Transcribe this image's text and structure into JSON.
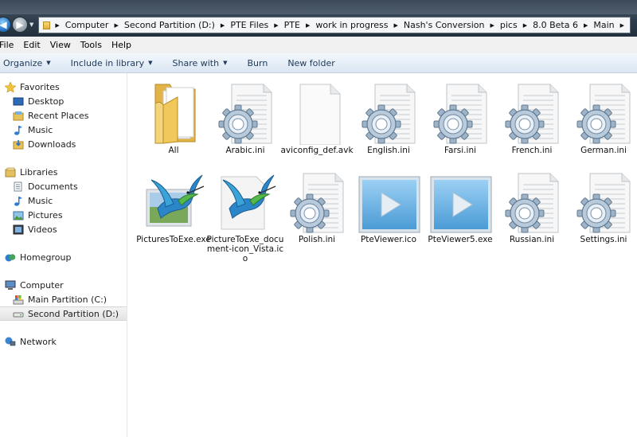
{
  "breadcrumb": [
    "Computer",
    "Second Partition (D:)",
    "PTE Files",
    "PTE",
    "work in progress",
    "Nash's Conversion",
    "pics",
    "8.0 Beta 6",
    "Main"
  ],
  "menu": [
    "File",
    "Edit",
    "View",
    "Tools",
    "Help"
  ],
  "toolbar": {
    "organize": "Organize",
    "include": "Include in library",
    "share": "Share with",
    "burn": "Burn",
    "new_folder": "New folder"
  },
  "nav": {
    "favorites": "Favorites",
    "desktop": "Desktop",
    "recent": "Recent Places",
    "music_fav": "Music",
    "downloads": "Downloads",
    "libraries": "Libraries",
    "documents": "Documents",
    "music_lib": "Music",
    "pictures": "Pictures",
    "videos": "Videos",
    "homegroup": "Homegroup",
    "computer": "Computer",
    "main_partition": "Main Partition (C:)",
    "second_partition": "Second Partition (D:)",
    "network": "Network"
  },
  "files": [
    {
      "name": "All",
      "icon": "folder-icon"
    },
    {
      "name": "Arabic.ini",
      "icon": "settings-file-icon"
    },
    {
      "name": "aviconfig_def.avk",
      "icon": "blank-file-icon"
    },
    {
      "name": "English.ini",
      "icon": "settings-file-icon"
    },
    {
      "name": "Farsi.ini",
      "icon": "settings-file-icon"
    },
    {
      "name": "French.ini",
      "icon": "settings-file-icon"
    },
    {
      "name": "German.ini",
      "icon": "settings-file-icon"
    },
    {
      "name": "PicturesToExe.exe",
      "icon": "hummingbird-app-icon"
    },
    {
      "name": "PictureToExe_document-icon_Vista.ico",
      "icon": "hummingbird-document-icon"
    },
    {
      "name": "Polish.ini",
      "icon": "settings-file-icon"
    },
    {
      "name": "PteViewer.ico",
      "icon": "play-icon"
    },
    {
      "name": "PteViewer5.exe",
      "icon": "play-icon"
    },
    {
      "name": "Russian.ini",
      "icon": "settings-file-icon"
    },
    {
      "name": "Settings.ini",
      "icon": "settings-file-icon"
    }
  ]
}
